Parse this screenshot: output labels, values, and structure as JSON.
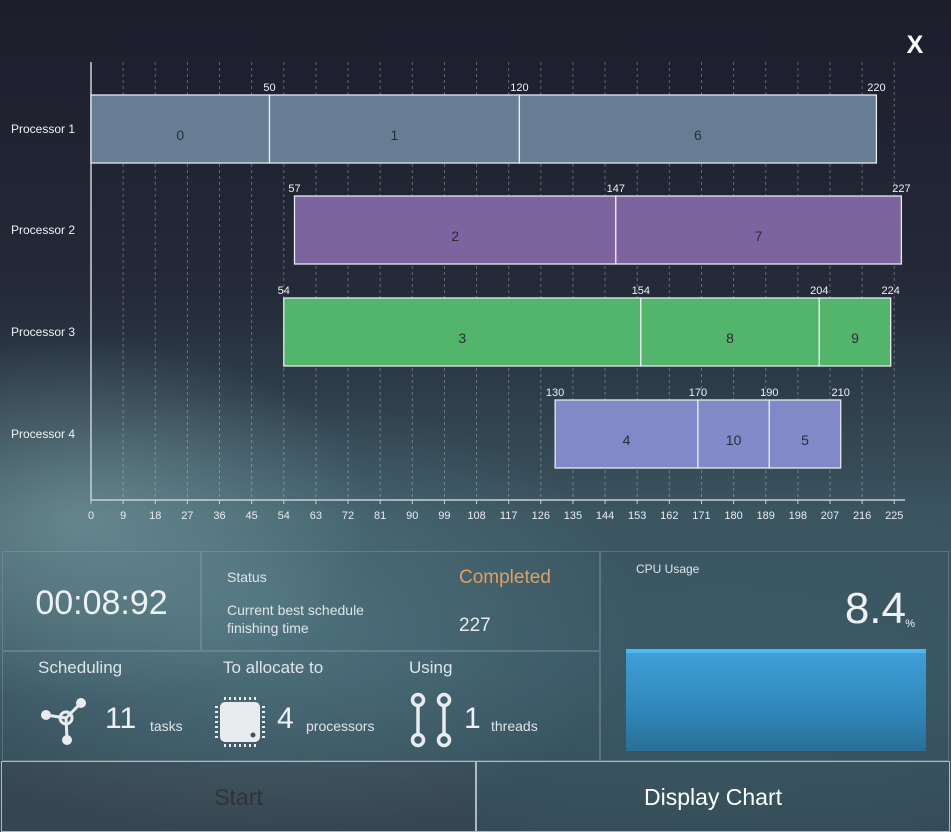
{
  "close_label": "X",
  "chart_data": {
    "type": "gantt",
    "processors": [
      "Processor 1",
      "Processor 2",
      "Processor 3",
      "Processor 4"
    ],
    "tasks": [
      {
        "processor": 0,
        "label": "0",
        "start": 0,
        "end": 50,
        "show_start": false
      },
      {
        "processor": 0,
        "label": "1",
        "start": 50,
        "end": 120,
        "show_start": true
      },
      {
        "processor": 0,
        "label": "6",
        "start": 120,
        "end": 220,
        "show_start": true
      },
      {
        "processor": 1,
        "label": "2",
        "start": 57,
        "end": 147,
        "show_start": true
      },
      {
        "processor": 1,
        "label": "7",
        "start": 147,
        "end": 227,
        "show_start": true
      },
      {
        "processor": 2,
        "label": "3",
        "start": 54,
        "end": 154,
        "show_start": true
      },
      {
        "processor": 2,
        "label": "8",
        "start": 154,
        "end": 204,
        "show_start": true
      },
      {
        "processor": 2,
        "label": "9",
        "start": 204,
        "end": 224,
        "show_start": true
      },
      {
        "processor": 3,
        "label": "4",
        "start": 130,
        "end": 170,
        "show_start": true
      },
      {
        "processor": 3,
        "label": "10",
        "start": 170,
        "end": 190,
        "show_start": true
      },
      {
        "processor": 3,
        "label": "5",
        "start": 190,
        "end": 210,
        "show_start": true
      }
    ],
    "colors": [
      "#667d93",
      "#7c659e",
      "#52b56b",
      "#8289c8"
    ],
    "xticks": [
      0,
      9,
      18,
      27,
      36,
      45,
      54,
      63,
      72,
      81,
      90,
      99,
      108,
      117,
      126,
      135,
      144,
      153,
      162,
      171,
      180,
      189,
      198,
      207,
      216,
      225
    ],
    "xlim": [
      0,
      228
    ],
    "grid": "vertical-dashed"
  },
  "timer": "00:08:92",
  "status": {
    "label": "Status",
    "value": "Completed",
    "best_label": "Current best schedule finishing time",
    "best_value": "227"
  },
  "info": {
    "scheduling": {
      "title": "Scheduling",
      "count": "11",
      "unit": "tasks",
      "icon": "network-icon"
    },
    "allocate": {
      "title": "To allocate to",
      "count": "4",
      "unit": "processors",
      "icon": "cpu-chip-icon"
    },
    "using": {
      "title": "Using",
      "count": "1",
      "unit": "threads",
      "icon": "thread-chain-icon"
    }
  },
  "cpu": {
    "label": "CPU Usage",
    "value": "8.4",
    "unit": "%",
    "usage_fraction": 0.084,
    "color": "#3e9fd8"
  },
  "buttons": {
    "start": "Start",
    "display_chart": "Display Chart"
  }
}
